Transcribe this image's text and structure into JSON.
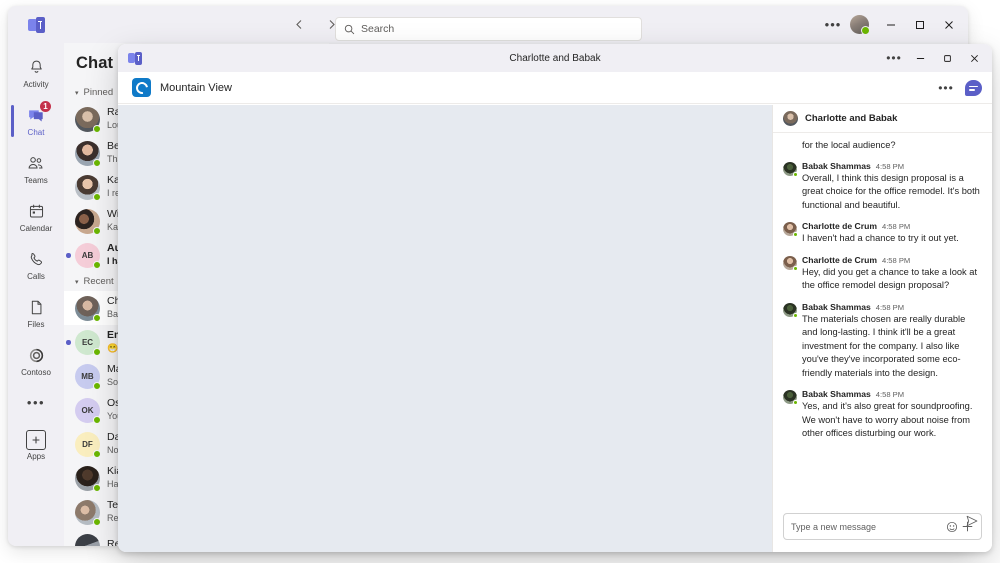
{
  "main_window": {
    "logo_icon": "teams-logo",
    "nav_back_icon": "chevron-left-icon",
    "nav_forward_icon": "chevron-right-icon",
    "search": {
      "placeholder": "Search",
      "icon": "search-icon",
      "value": ""
    },
    "more_label": "•••",
    "minimize_label": "minimize",
    "maximize_label": "maximize",
    "close_label": "close",
    "rail": [
      {
        "label": "Activity",
        "icon": "bell-icon",
        "active": false,
        "badge": ""
      },
      {
        "label": "Chat",
        "icon": "chat-icon",
        "active": true,
        "badge": "1"
      },
      {
        "label": "Teams",
        "icon": "teams-people-icon",
        "active": false,
        "badge": ""
      },
      {
        "label": "Calendar",
        "icon": "calendar-icon",
        "active": false,
        "badge": ""
      },
      {
        "label": "Calls",
        "icon": "phone-icon",
        "active": false,
        "badge": ""
      },
      {
        "label": "Files",
        "icon": "file-icon",
        "active": false,
        "badge": ""
      },
      {
        "label": "Contoso",
        "icon": "contoso-spiral-icon",
        "active": false,
        "badge": ""
      }
    ],
    "rail_more_label": "•••",
    "rail_apps": {
      "label": "Apps",
      "icon": "apps-plus-icon"
    },
    "chat_panel": {
      "title": "Chat",
      "chevron_icon": "chevron-down-icon",
      "sections": [
        {
          "label": "Pinned",
          "rows": [
            {
              "name": "Ray Ta",
              "preview": "Louisa",
              "avatar_type": "photo",
              "avatar_class": "ph1",
              "initials": "",
              "unread": false,
              "selected": false,
              "bold": false
            },
            {
              "name": "Beth D",
              "preview": "Thanks",
              "avatar_type": "photo",
              "avatar_class": "ph2",
              "initials": "",
              "unread": false,
              "selected": false,
              "bold": false
            },
            {
              "name": "Kayo I",
              "preview": "I review",
              "avatar_type": "photo",
              "avatar_class": "ph3",
              "initials": "",
              "unread": false,
              "selected": false,
              "bold": false
            },
            {
              "name": "Will, K",
              "preview": "Kayo: It",
              "avatar_type": "photo",
              "avatar_class": "ph4",
              "initials": "",
              "unread": false,
              "selected": false,
              "bold": false
            },
            {
              "name": "Augus",
              "preview": "I haven",
              "avatar_type": "initials",
              "avatar_color": "#f5cdd8",
              "initials": "AB",
              "unread": true,
              "selected": false,
              "bold": true
            }
          ]
        },
        {
          "label": "Recent",
          "rows": [
            {
              "name": "Charlo",
              "preview": "Babak:",
              "avatar_type": "photo",
              "avatar_class": "ph5",
              "initials": "",
              "unread": false,
              "selected": true,
              "bold": false
            },
            {
              "name": "Emilia",
              "preview": "😁😁",
              "avatar_type": "initials",
              "avatar_color": "#cfe8cf",
              "initials": "EC",
              "unread": true,
              "selected": false,
              "bold": true
            },
            {
              "name": "Marie",
              "preview": "Sounds",
              "avatar_type": "initials",
              "avatar_color": "#c7cbef",
              "initials": "MB",
              "unread": false,
              "selected": false,
              "bold": false
            },
            {
              "name": "Oscar",
              "preview": "You: Th",
              "avatar_type": "initials",
              "avatar_color": "#d4ccf0",
              "initials": "OK",
              "unread": false,
              "selected": false,
              "bold": false
            },
            {
              "name": "Daichi",
              "preview": "No, I th",
              "avatar_type": "initials",
              "avatar_color": "#faeebf",
              "initials": "DF",
              "unread": false,
              "selected": false,
              "bold": false
            },
            {
              "name": "Kian L",
              "preview": "Have y",
              "avatar_type": "photo",
              "avatar_class": "ph6",
              "initials": "",
              "unread": false,
              "selected": false,
              "bold": false
            },
            {
              "name": "Team",
              "preview": "Reta: L",
              "avatar_type": "photo",
              "avatar_class": "ph7",
              "initials": "",
              "unread": false,
              "selected": false,
              "bold": false
            },
            {
              "name": "Review",
              "preview": "",
              "avatar_type": "photo",
              "avatar_class": "ph8",
              "initials": "",
              "unread": false,
              "selected": false,
              "bold": false
            }
          ]
        }
      ]
    }
  },
  "popout_window": {
    "title": "Charlotte and Babak",
    "logo_icon": "teams-logo",
    "more_label": "•••",
    "minimize_label": "minimize",
    "restore_label": "restore",
    "close_label": "close",
    "app_bar": {
      "app_name": "Mountain View",
      "app_icon": "mountain-view-app-icon",
      "more_label": "•••",
      "chat_toggle_icon": "chat-bubble-icon"
    },
    "chat_panel": {
      "header_title": "Charlotte and Babak",
      "header_avatar_icon": "group-avatar",
      "partial_message": "for the local audience?",
      "messages": [
        {
          "author": "Babak Shammas",
          "time": "4:58 PM",
          "text": "Overall, I think this design proposal is a great choice for the office remodel. It's both functional and beautiful.",
          "avatar_class": "avB"
        },
        {
          "author": "Charlotte de Crum",
          "time": "4:58 PM",
          "text": "I haven't had a chance to try it out yet.",
          "avatar_class": "avC"
        },
        {
          "author": "Charlotte de Crum",
          "time": "4:58 PM",
          "text": "Hey, did you get a chance to take a look at the office remodel design proposal?",
          "avatar_class": "avC"
        },
        {
          "author": "Babak Shammas",
          "time": "4:58 PM",
          "text": "The materials chosen are really durable and long-lasting. I think it'll be a great investment for the company. I also like you've they've incorporated some eco-friendly materials into the design.",
          "avatar_class": "avB"
        },
        {
          "author": "Babak Shammas",
          "time": "4:58 PM",
          "text": "Yes, and it's also great for soundproofing. We won't have to worry about noise from other offices disturbing our work.",
          "avatar_class": "avB"
        }
      ],
      "composer": {
        "placeholder": "Type a new message",
        "value": "",
        "emoji_icon": "emoji-icon",
        "plus_icon": "plus-icon",
        "send_icon": "send-icon"
      }
    }
  }
}
